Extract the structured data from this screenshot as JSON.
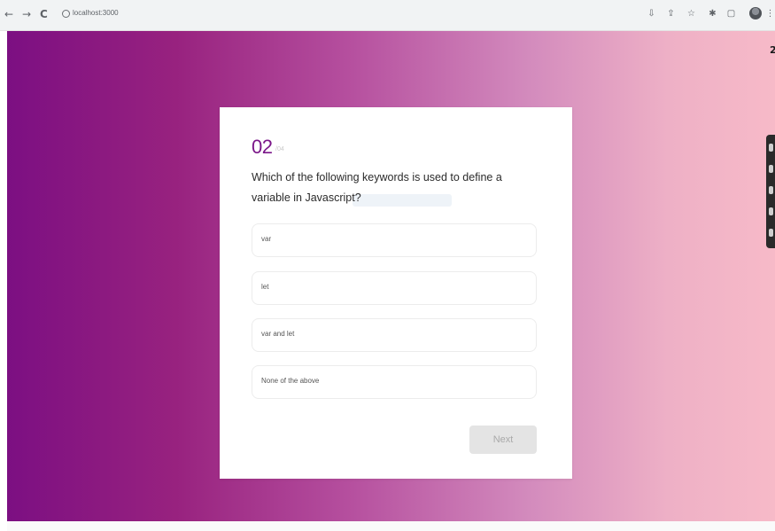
{
  "browser": {
    "url": "localhost:3000",
    "nav": {
      "back": "←",
      "forward": "→",
      "reload": "C"
    },
    "toolbar_icons": [
      "download-icon",
      "share-icon",
      "star-icon",
      "extensions-icon",
      "sidebar-icon",
      "profile-avatar",
      "menu-icon"
    ]
  },
  "page": {
    "corner_mark": "2",
    "background_gradient": [
      "#7c0f82",
      "#b6509f",
      "#f7bac8"
    ]
  },
  "quiz": {
    "question_number": "02",
    "question_total": "/04",
    "question_text": "Which of the following keywords is used to define a variable in Javascript?",
    "options": [
      "var",
      "let",
      "var and let",
      "None of the above"
    ],
    "next_label": "Next",
    "accent_color": "#7b1789"
  }
}
